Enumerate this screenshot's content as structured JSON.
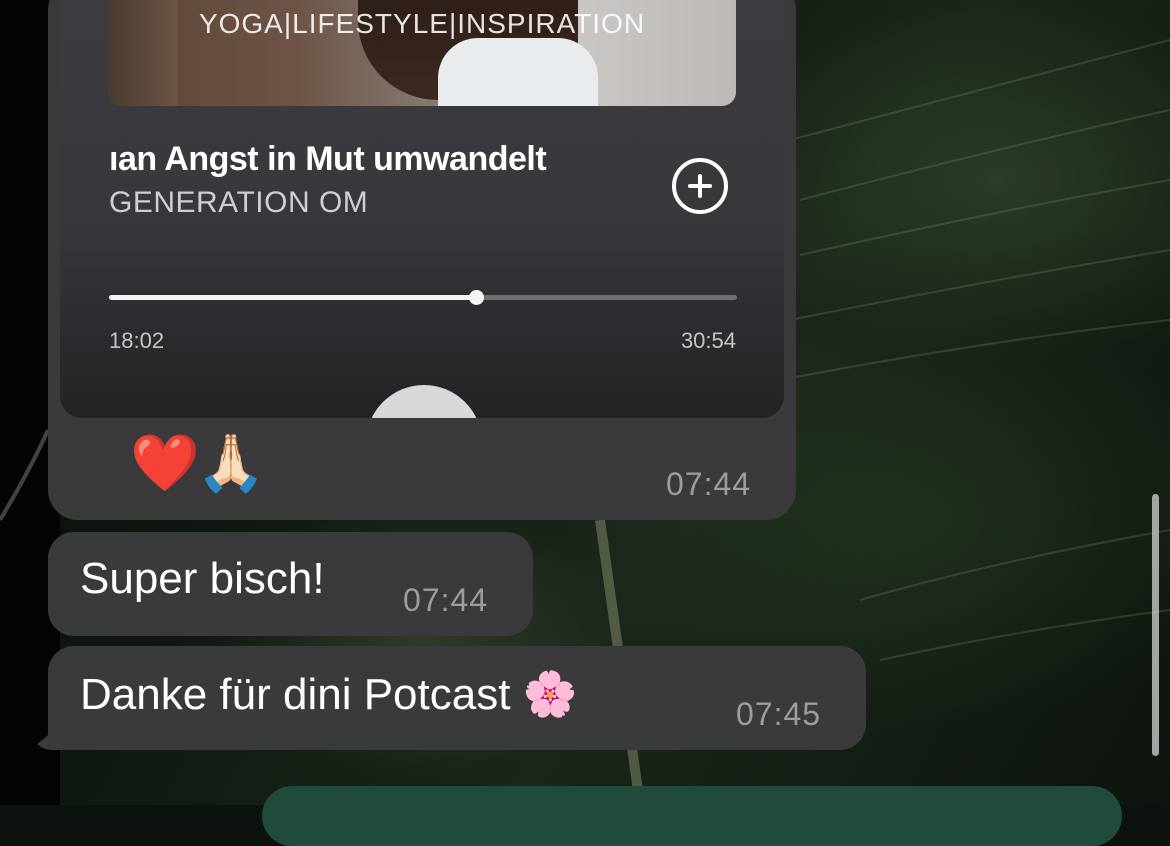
{
  "player": {
    "cover_slogan": "YOGA|LIFESTYLE|INSPIRATION",
    "track_title": "ıan Angst in Mut umwandelt",
    "artist": "GENERATION OM",
    "add_icon": "plus-circle-icon",
    "elapsed": "18:02",
    "total": "30:54",
    "progress_fraction": 0.584,
    "play_icon": "play-icon"
  },
  "messages": [
    {
      "reactions": [
        "❤️",
        "🙏🏻"
      ],
      "time": "07:44"
    },
    {
      "text": "Super bisch!",
      "time": "07:44"
    },
    {
      "text": "Danke für dini Potcast 🌸",
      "time": "07:45"
    }
  ],
  "colors": {
    "bubble": "#3a3a3c",
    "compose_accent": "#1f4a3c",
    "timestamp": "#9c9ca2"
  }
}
